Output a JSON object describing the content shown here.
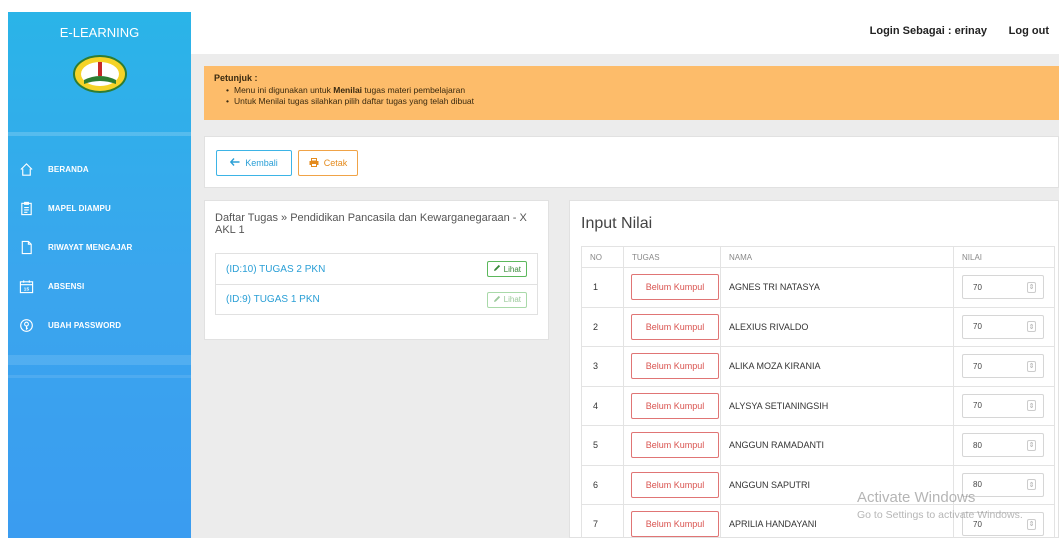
{
  "app": {
    "title": "E-LEARNING"
  },
  "sidebar": {
    "items": [
      {
        "label": "BERANDA",
        "icon": "home-icon"
      },
      {
        "label": "MAPEL DIAMPU",
        "icon": "clipboard-icon"
      },
      {
        "label": "RIWAYAT MENGAJAR",
        "icon": "document-icon"
      },
      {
        "label": "ABSENSI",
        "icon": "calendar-icon"
      },
      {
        "label": "UBAH PASSWORD",
        "icon": "key-icon"
      }
    ]
  },
  "header": {
    "login_text": "Login Sebagai : erinay",
    "logout_label": "Log out"
  },
  "notice": {
    "title": "Petunjuk :",
    "line1_prefix": "Menu ini digunakan untuk ",
    "line1_bold": "Menilai",
    "line1_suffix": " tugas materi pembelajaran",
    "line2": "Untuk Menilai tugas silahkan pilih daftar tugas yang telah dibuat"
  },
  "buttons": {
    "back_label": "Kembali",
    "print_label": "Cetak"
  },
  "daftar": {
    "title": "Daftar Tugas » Pendidikan Pancasila dan Kewarganegaraan - X AKL 1",
    "view_label": "Lihat",
    "tasks": [
      "(ID:10) TUGAS 2 PKN",
      "(ID:9) TUGAS 1 PKN"
    ]
  },
  "nilai": {
    "title": "Input Nilai",
    "headers": {
      "no": "NO",
      "tugas": "TUGAS",
      "nama": "NAMA",
      "nilai": "NILAI"
    },
    "status_label": "Belum Kumpul",
    "rows": [
      {
        "no": "1",
        "nama": "AGNES TRI NATASYA",
        "nilai": "70"
      },
      {
        "no": "2",
        "nama": "ALEXIUS RIVALDO",
        "nilai": "70"
      },
      {
        "no": "3",
        "nama": "ALIKA MOZA KIRANIA",
        "nilai": "70"
      },
      {
        "no": "4",
        "nama": "ALYSYA SETIANINGSIH",
        "nilai": "70"
      },
      {
        "no": "5",
        "nama": "ANGGUN RAMADANTI",
        "nilai": "80"
      },
      {
        "no": "6",
        "nama": "ANGGUN SAPUTRI",
        "nilai": "80"
      },
      {
        "no": "7",
        "nama": "APRILIA HANDAYANI",
        "nilai": "70"
      }
    ]
  },
  "watermark": {
    "line1": "Activate Windows",
    "line2": "Go to Settings to activate Windows."
  }
}
